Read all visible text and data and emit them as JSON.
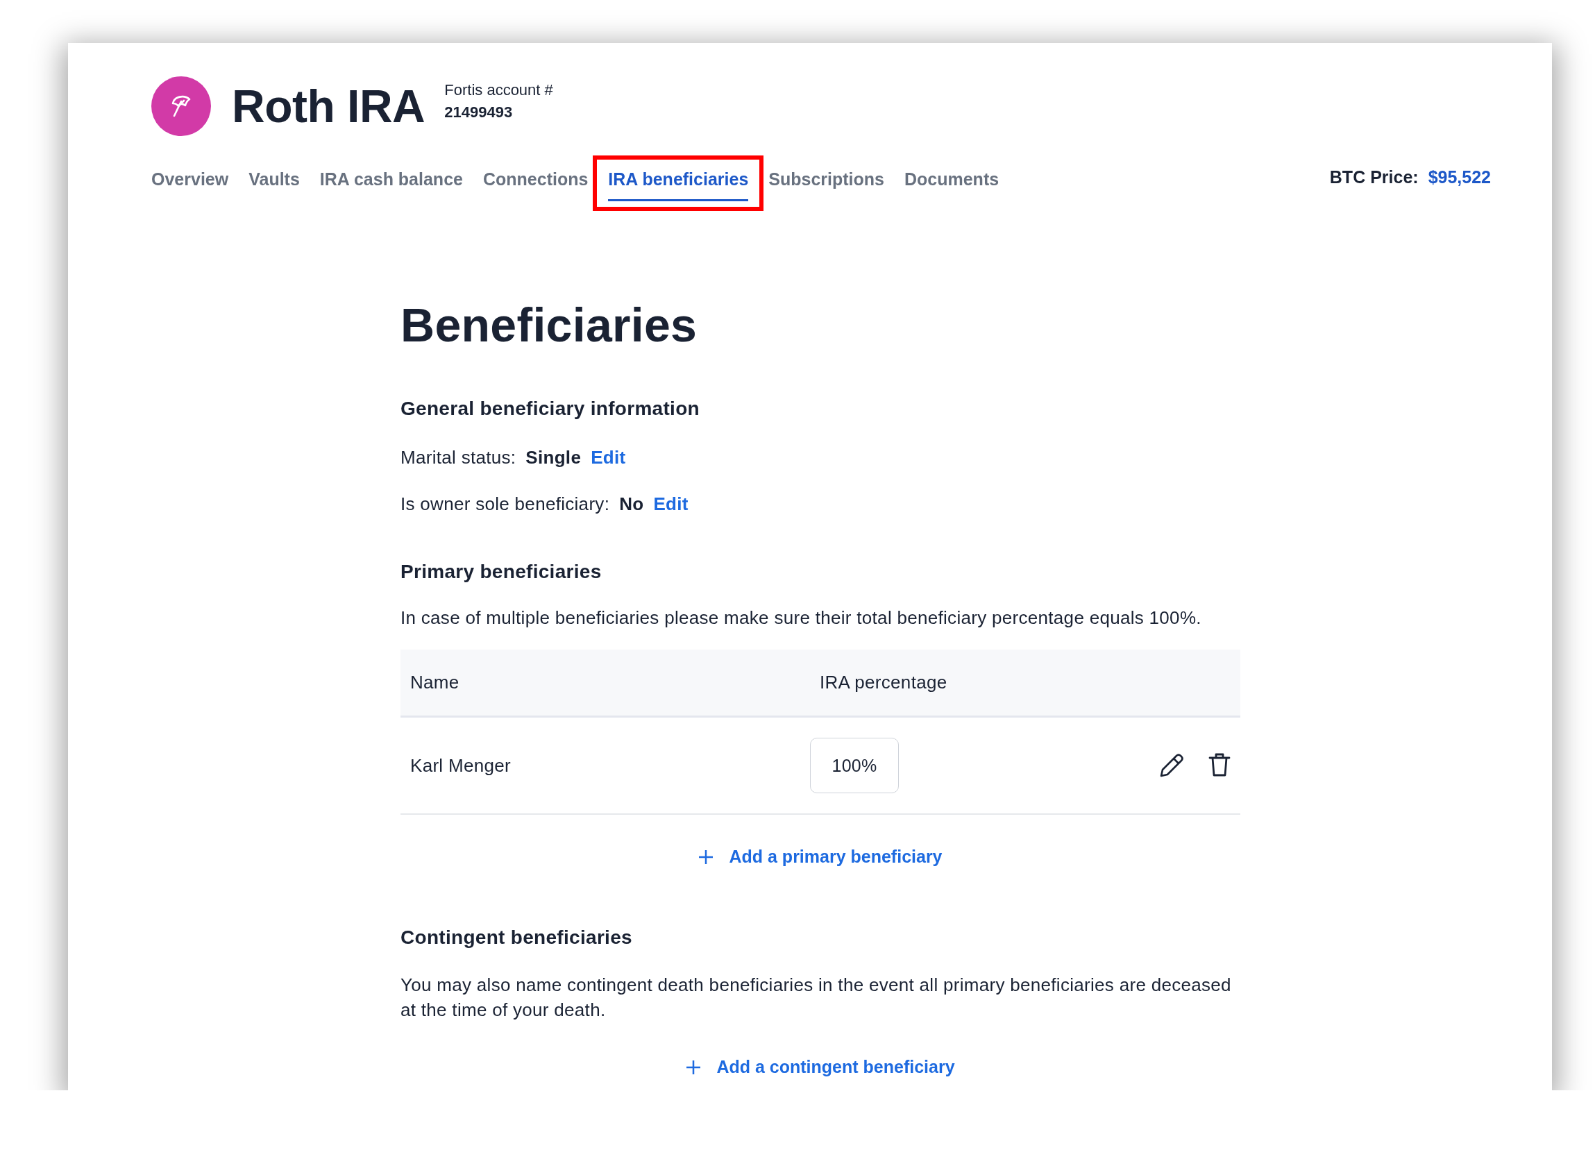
{
  "account": {
    "title": "Roth IRA",
    "label": "Fortis account #",
    "number": "21499493"
  },
  "tabs": [
    {
      "label": "Overview",
      "selected": false,
      "highlighted": false
    },
    {
      "label": "Vaults",
      "selected": false,
      "highlighted": false
    },
    {
      "label": "IRA cash balance",
      "selected": false,
      "highlighted": false
    },
    {
      "label": "Connections",
      "selected": false,
      "highlighted": false
    },
    {
      "label": "IRA beneficiaries",
      "selected": true,
      "highlighted": true
    },
    {
      "label": "Subscriptions",
      "selected": false,
      "highlighted": false
    },
    {
      "label": "Documents",
      "selected": false,
      "highlighted": false
    }
  ],
  "btc_price": {
    "label": "BTC Price:",
    "value": "$95,522"
  },
  "page_title": "Beneficiaries",
  "general": {
    "heading": "General beneficiary information",
    "fields": [
      {
        "label": "Marital status:",
        "value": "Single",
        "action": "Edit"
      },
      {
        "label": "Is owner sole beneficiary:",
        "value": "No",
        "action": "Edit"
      }
    ]
  },
  "primary": {
    "heading": "Primary beneficiaries",
    "note": "In case of multiple beneficiaries please make sure their total beneficiary percentage equals 100%.",
    "table": {
      "columns": [
        "Name",
        "IRA percentage"
      ],
      "rows": [
        {
          "name": "Karl Menger",
          "percentage": "100%"
        }
      ]
    },
    "add_button": "Add a primary beneficiary"
  },
  "contingent": {
    "heading": "Contingent beneficiaries",
    "note": "You may also name contingent death beneficiaries in the event all primary beneficiaries are deceased at the time of your death.",
    "add_button": "Add a contingent beneficiary"
  }
}
